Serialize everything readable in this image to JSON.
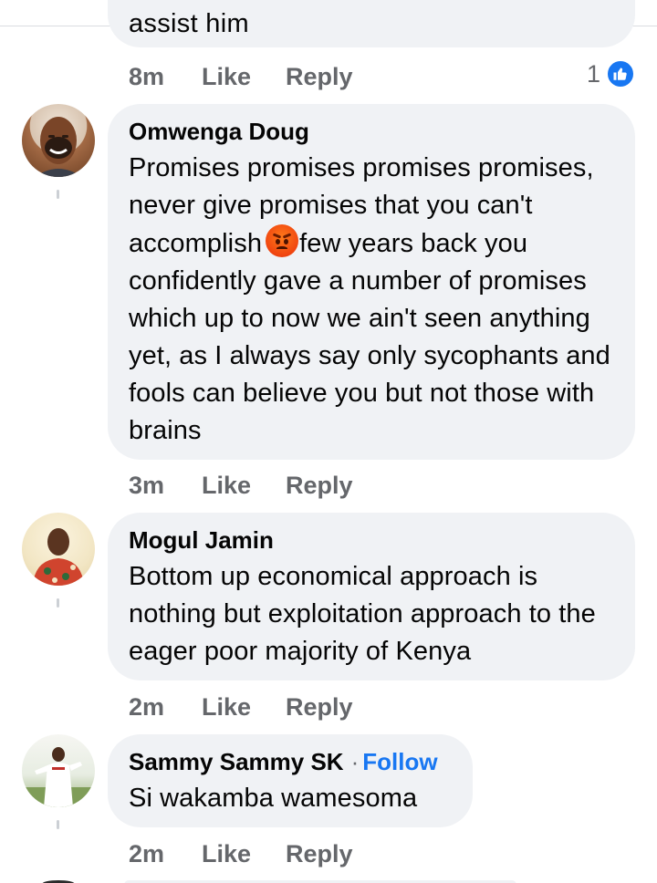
{
  "previous_comment": {
    "partial_text": "assist him",
    "time": "8m",
    "like_label": "Like",
    "reply_label": "Reply",
    "reaction_count": "1",
    "reaction_icon": "thumbs-up-icon"
  },
  "comments": [
    {
      "author": "Omwenga Doug",
      "text_before_emoji": "Promises promises promises promises, never give promises that you can't accomplish",
      "emoji": "angry-face",
      "text_after_emoji": "few years back you confidently gave a number of promises which up to now we ain't seen anything yet, as I always say only sycophants and fools can believe you but not those with brains",
      "time": "3m",
      "like_label": "Like",
      "reply_label": "Reply"
    },
    {
      "author": "Mogul Jamin",
      "text": "Bottom up economical approach is nothing but exploitation approach to the eager poor majority of Kenya",
      "time": "2m",
      "like_label": "Like",
      "reply_label": "Reply"
    },
    {
      "author": "Sammy Sammy SK",
      "separator": "·",
      "follow_label": "Follow",
      "text": "Si wakamba wamesoma",
      "time": "2m",
      "like_label": "Like",
      "reply_label": "Reply"
    }
  ],
  "colors": {
    "bubble": "#f0f2f5",
    "action_text": "#65676b",
    "follow": "#1877f2",
    "like_badge": "#1877f2"
  }
}
